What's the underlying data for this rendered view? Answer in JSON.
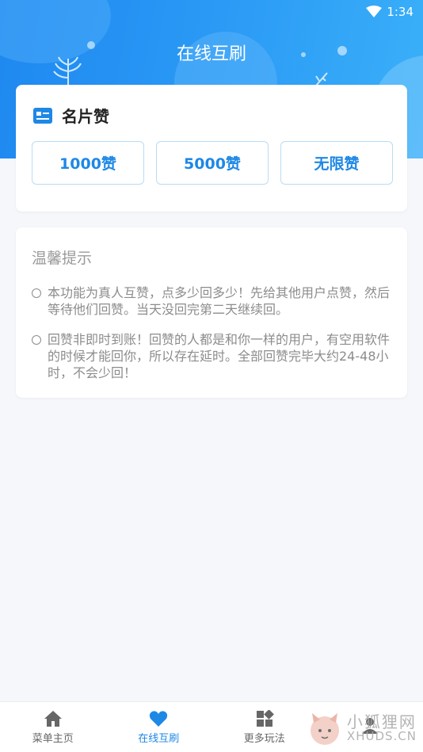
{
  "status_bar": {
    "time": "1:34"
  },
  "header": {
    "title": "在线互刷"
  },
  "card": {
    "label": "名片赞",
    "options": [
      "1000赞",
      "5000赞",
      "无限赞"
    ]
  },
  "tips": {
    "title": "温馨提示",
    "items": [
      "本功能为真人互赞，点多少回多少！先给其他用户点赞，然后等待他们回赞。当天没回完第二天继续回。",
      "回赞非即时到账！回赞的人都是和你一样的用户，有空用软件的时候才能回你，所以存在延时。全部回赞完毕大约24-48小时，不会少回！"
    ]
  },
  "tabbar": {
    "tabs": [
      "菜单主页",
      "在线互刷",
      "更多玩法",
      ""
    ]
  },
  "watermark": {
    "cn": "小狐狸网",
    "en": "XHUDS.CN"
  },
  "colors": {
    "accent": "#1e88e5",
    "header_bg": "#2c9cf6"
  }
}
